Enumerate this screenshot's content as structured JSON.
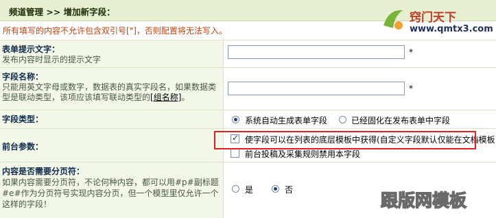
{
  "header": {
    "breadcrumb": "频道管理 >> 增加新字段："
  },
  "warning": "所有填写的内容不允许包含双引号[\"]，否则配置将无法写入。",
  "rows": {
    "form_tip": {
      "label": "表单提示文字：",
      "desc": "发布内容时显示的提示文字",
      "value": "",
      "required_mark": "*"
    },
    "field_name": {
      "label": "字段名称：",
      "desc": "只能用英文字母或数字，数据表的真实字段名，如果数据类型是联动类型，该项应该填写联动类型的",
      "link": "[组名称]",
      "desc_end": "。",
      "value": "",
      "required_mark": "*"
    },
    "field_type": {
      "label": "字段类型：",
      "options": [
        "系统自动生成表单字段",
        "已经固化在发布表单中字段"
      ],
      "selected": 0
    },
    "frontend_params": {
      "label": "前台参数：",
      "options": [
        "使字段可以在列表的底层模板中获得(自定义字段默认仅能在文档模板",
        "前台投稿及采集规则禁用本字段"
      ],
      "checked": [
        true,
        false
      ]
    },
    "paging": {
      "label": "内容是否需要分页符：",
      "desc": "如果内容需要分页符，不论何种内容，都可以用#p#副标题#e#作为分页符号实现内容分页，但一个模型里仅允许一个这样的字段！",
      "options": [
        "是",
        "否"
      ],
      "selected": 1
    }
  },
  "watermarks": {
    "top_right_name": "窍门天下",
    "top_right_url": "www.qmtx3.com",
    "bottom_right": "跟版网模板"
  },
  "colors": {
    "header_bg": "#e6efd0",
    "label_bg": "#f3f7e8",
    "warning": "#c2420c",
    "highlight": "#e02020"
  }
}
